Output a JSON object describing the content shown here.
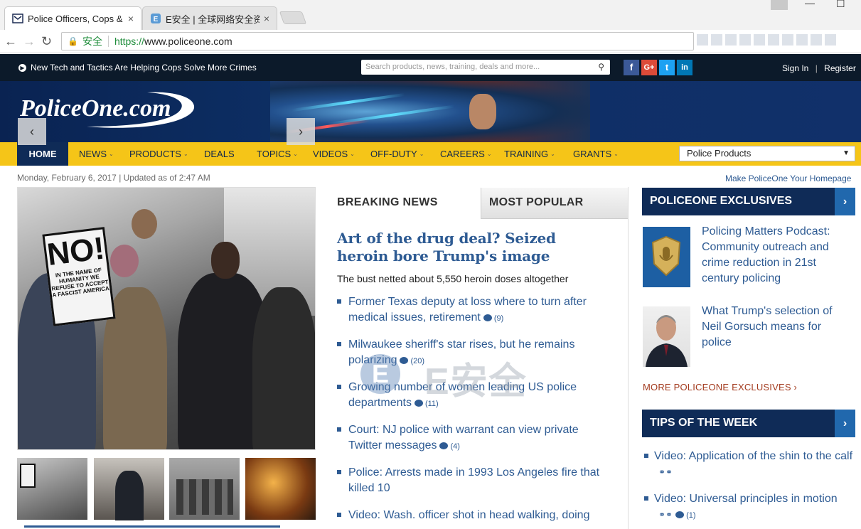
{
  "browser": {
    "tabs": [
      {
        "title": "Police Officers, Cops &",
        "close": "×"
      },
      {
        "title": "E安全 | 全球网络安全资",
        "close": "×"
      }
    ],
    "window_controls": {
      "minimize": "—",
      "maximize": "☐"
    },
    "nav": {
      "back": "←",
      "forward": "→",
      "reload": "↻"
    },
    "address": {
      "secure_label": "安全",
      "url_scheme": "https://",
      "url_host": "www.policeone.com"
    }
  },
  "site": {
    "ticker": "New Tech and Tactics Are Helping Cops Solve More Crimes",
    "search_placeholder": "Search products, news, training, deals and more...",
    "social": [
      {
        "name": "facebook-icon",
        "glyph": "f",
        "color": "#3b5998"
      },
      {
        "name": "google-plus-icon",
        "glyph": "G+",
        "color": "#dd4b39"
      },
      {
        "name": "twitter-icon",
        "glyph": "t",
        "color": "#1da1f2"
      },
      {
        "name": "linkedin-icon",
        "glyph": "in",
        "color": "#0077b5"
      }
    ],
    "sign_in": "Sign In",
    "auth_sep": "|",
    "register": "Register",
    "logo": "PoliceOne.com",
    "nav": {
      "home": "HOME",
      "items": [
        "NEWS",
        "PRODUCTS",
        "DEALS",
        "TOPICS",
        "VIDEOS",
        "OFF-DUTY",
        "CAREERS",
        "TRAINING",
        "GRANTS"
      ],
      "has_dropdown": [
        true,
        true,
        false,
        true,
        true,
        true,
        true,
        true,
        true
      ]
    },
    "product_select": "Police Products",
    "dateline": "Monday, February 6, 2017 | Updated as of 2:47 AM",
    "make_homepage": "Make PoliceOne Your Homepage",
    "accent": "#f5c518",
    "navy": "#0f2b57"
  },
  "carousel": {
    "sign_big": "NO!",
    "sign_small": "IN THE NAME OF HUMANITY WE REFUSE TO ACCEPT A FASCIST AMERICA",
    "prev": "‹",
    "next": "›"
  },
  "news": {
    "tab_breaking": "BREAKING NEWS",
    "tab_popular": "MOST POPULAR",
    "lead_title": "Art of the drug deal? Seized heroin bore Trump's image",
    "lead_sub": "The bust netted about 5,550 heroin doses altogether",
    "items": [
      {
        "text": "Former Texas deputy at loss where to turn after medical issues, retirement",
        "comments": "(9)"
      },
      {
        "text": "Milwaukee sheriff's star rises, but he remains polarizing",
        "comments": "(20)"
      },
      {
        "text": "Growing number of women leading US police departments",
        "comments": "(11)"
      },
      {
        "text": "Court: NJ police with warrant can view private Twitter messages",
        "comments": "(4)"
      },
      {
        "text": "Police: Arrests made in 1993 Los Angeles fire that killed 10",
        "comments": ""
      },
      {
        "text": "Video: Wash. officer shot in head walking, doing",
        "comments": ""
      }
    ],
    "watermark_letter": "E",
    "watermark_text": "E安全"
  },
  "sidebar": {
    "exclusives_title": "POLICEONE EXCLUSIVES",
    "exclusives": [
      {
        "text": "Policing Matters Podcast: Community outreach and crime reduction in 21st century policing"
      },
      {
        "text": "What Trump's selection of Neil Gorsuch means for police"
      }
    ],
    "more_exclusives": "MORE POLICEONE EXCLUSIVES",
    "tips_title": "TIPS OF THE WEEK",
    "tips": [
      {
        "text": "Video: Application of the shin to the calf",
        "comments": ""
      },
      {
        "text": "Video: Universal principles in motion",
        "comments": "(1)"
      }
    ]
  }
}
